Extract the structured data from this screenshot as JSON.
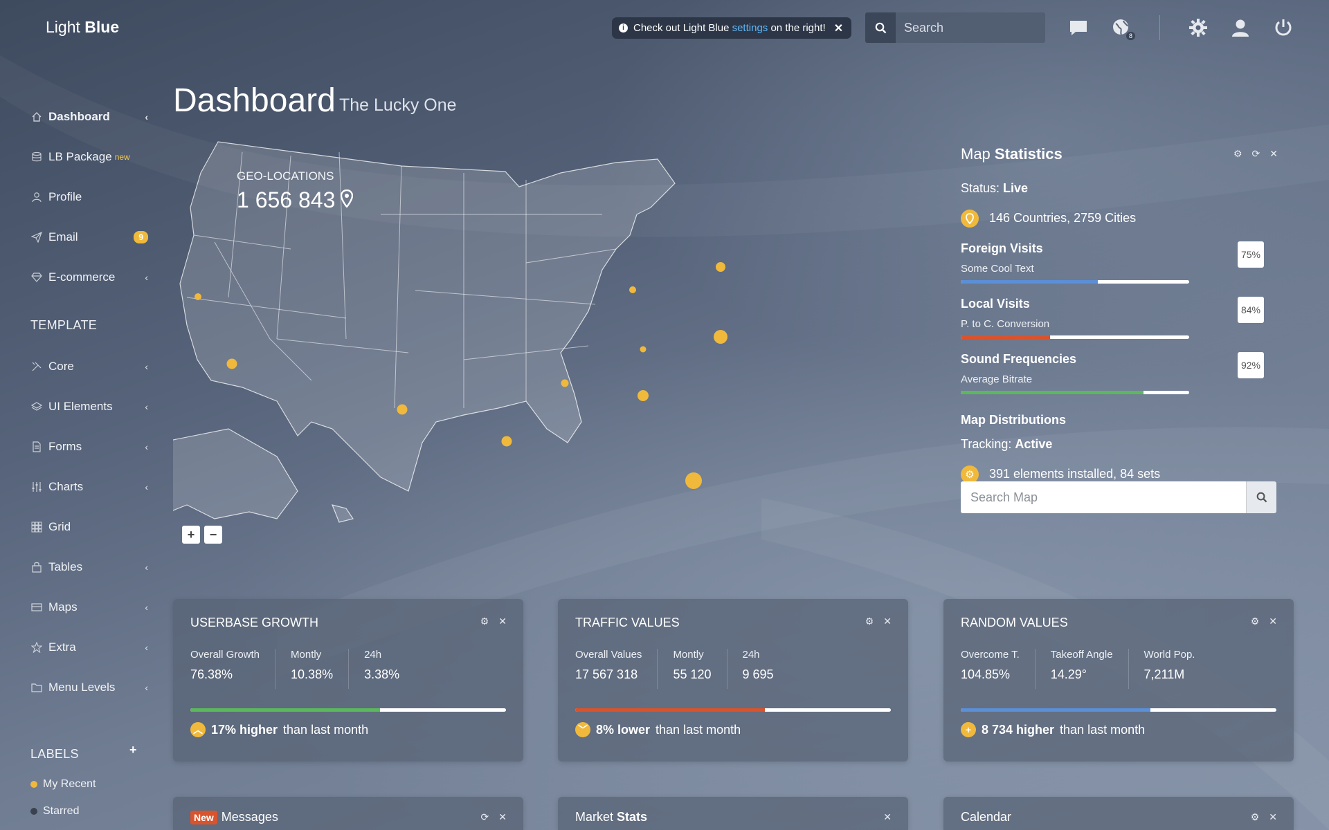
{
  "header": {
    "logo_light": "Light",
    "logo_bold": "Blue",
    "notice": {
      "text_before": "Check out Light Blue",
      "link": "settings",
      "text_after": "on the right!"
    },
    "search_placeholder": "Search",
    "notifications_count": "8"
  },
  "sidebar": {
    "items": [
      {
        "label": "Dashboard",
        "icon": "home-icon"
      },
      {
        "label": "LB Package",
        "sup": "new",
        "icon": "database-icon"
      },
      {
        "label": "Profile",
        "icon": "user-icon"
      },
      {
        "label": "Email",
        "badge": "9",
        "icon": "paper-plane-icon"
      },
      {
        "label": "E-commerce",
        "icon": "diamond-icon"
      }
    ],
    "template_title": "TEMPLATE",
    "template_items": [
      {
        "label": "Core",
        "icon": "tools-icon"
      },
      {
        "label": "UI Elements",
        "icon": "layers-icon"
      },
      {
        "label": "Forms",
        "icon": "document-icon"
      },
      {
        "label": "Charts",
        "icon": "sliders-icon"
      },
      {
        "label": "Grid",
        "icon": "grid-icon"
      },
      {
        "label": "Tables",
        "icon": "bag-icon"
      },
      {
        "label": "Maps",
        "icon": "card-icon"
      },
      {
        "label": "Extra",
        "icon": "star-icon"
      },
      {
        "label": "Menu Levels",
        "icon": "folder-icon"
      }
    ],
    "labels_title": "LABELS",
    "labels": [
      {
        "label": "My Recent",
        "color": "#f0b93c"
      },
      {
        "label": "Starred",
        "color": "#3a4250"
      }
    ]
  },
  "page": {
    "title": "Dashboard",
    "subtitle": "The Lucky One"
  },
  "map": {
    "geo_label": "GEO-LOCATIONS",
    "geo_value": "1 656 843"
  },
  "map_stats": {
    "title_light": "Map",
    "title_bold": "Statistics",
    "status_label": "Status:",
    "status_value": "Live",
    "coverage": "146 Countries, 2759 Cities",
    "metrics": [
      {
        "title": "Foreign Visits",
        "sub": "Some Cool Text",
        "pct": "75%",
        "fill": 60,
        "color": "#5b8fd6"
      },
      {
        "title": "Local Visits",
        "sub": "P. to C. Conversion",
        "pct": "84%",
        "fill": 39,
        "color": "#d9532c"
      },
      {
        "title": "Sound Frequencies",
        "sub": "Average Bitrate",
        "pct": "92%",
        "fill": 80,
        "color": "#5cb85c"
      }
    ],
    "distributions_title": "Map Distributions",
    "tracking_label": "Tracking:",
    "tracking_value": "Active",
    "elements": "391 elements installed, 84 sets",
    "search_placeholder": "Search Map"
  },
  "cards": [
    {
      "title": "USERBASE GROWTH",
      "cols": [
        {
          "label": "Overall Growth",
          "value": "76.38%"
        },
        {
          "label": "Montly",
          "value": "10.38%"
        },
        {
          "label": "24h",
          "value": "3.38%"
        }
      ],
      "fill": 60,
      "color": "#5cb85c",
      "foot_bold": "17% higher",
      "foot_rest": "than last month",
      "icon": "chevron-up-icon"
    },
    {
      "title": "TRAFFIC VALUES",
      "cols": [
        {
          "label": "Overall Values",
          "value": "17 567 318"
        },
        {
          "label": "Montly",
          "value": "55 120"
        },
        {
          "label": "24h",
          "value": "9 695"
        }
      ],
      "fill": 60,
      "color": "#d9532c",
      "foot_bold": "8% lower",
      "foot_rest": "than last month",
      "icon": "chevron-down-icon"
    },
    {
      "title": "RANDOM VALUES",
      "cols": [
        {
          "label": "Overcome T.",
          "value": "104.85%"
        },
        {
          "label": "Takeoff Angle",
          "value": "14.29°"
        },
        {
          "label": "World Pop.",
          "value": "7,211M"
        }
      ],
      "fill": 60,
      "color": "#5b8fd6",
      "foot_bold": "8 734 higher",
      "foot_rest": "than last month",
      "icon": "plus-icon"
    }
  ],
  "bottom_cards": [
    {
      "tag": "New",
      "title": "Messages"
    },
    {
      "title_light": "Market",
      "title_bold": "Stats"
    },
    {
      "title": "Calendar"
    }
  ]
}
